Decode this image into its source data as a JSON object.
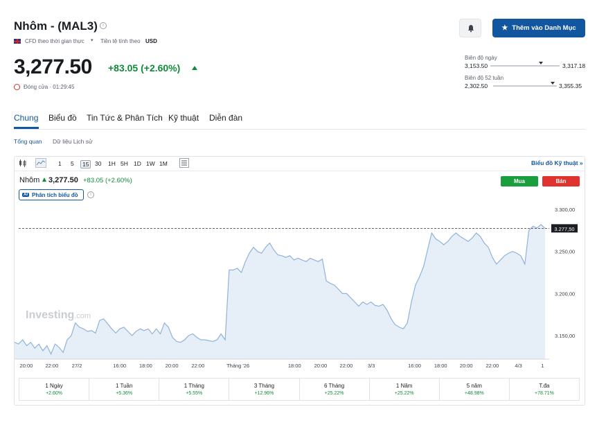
{
  "header": {
    "title": "Nhôm - (MAL3)",
    "cfd_label": "CFD theo thời gian thực",
    "currency_prefix": "Tiền tệ tính theo",
    "currency": "USD",
    "price": "3,277.50",
    "change": "+83.05 (+2.60%)",
    "closed_text": "Đóng cửa · 01:29:45",
    "watchlist_label": "Thêm vào Danh Mục"
  },
  "ranges": {
    "day_label": "Biên độ ngày",
    "day_low": "3,153.50",
    "day_high": "3,317.18",
    "day_position": 0.73,
    "week52_label": "Biên độ 52 tuần",
    "week52_low": "2,302.50",
    "week52_high": "3,355.35",
    "week52_position": 0.93
  },
  "tabs": [
    "Chung",
    "Biểu đồ",
    "Tin Tức & Phân Tích",
    "Kỹ thuật",
    "Diễn đàn"
  ],
  "subtabs": [
    "Tổng quan",
    "Dữ liệu Lịch sử"
  ],
  "toolbar": {
    "intervals": [
      "1",
      "5",
      "15",
      "30",
      "1H",
      "5H",
      "1D",
      "1W",
      "1M"
    ],
    "tech_chart_link": "Biểu đồ Kỹ thuật »"
  },
  "chart_header": {
    "name": "Nhôm",
    "price": "3,277.50",
    "change": "+83.05 (+2.60%)",
    "ai_label": "Phân tích biểu đồ",
    "buy": "Mua",
    "sell": "Bán",
    "watermark": "Investing",
    "watermark_suffix": ".com"
  },
  "chart_data": {
    "type": "area",
    "ylim": [
      3122,
      3305
    ],
    "yticks": [
      "3.300,00",
      "3.250,00",
      "3.200,00",
      "3.150,00"
    ],
    "ytick_values": [
      3300,
      3250,
      3200,
      3150
    ],
    "current_label": "3.277,50",
    "current_value": 3277.5,
    "xticks": [
      "20:00",
      "22:00",
      "27/2",
      "16:00",
      "18:00",
      "20:00",
      "22:00",
      "Tháng '26",
      "18:00",
      "20:00",
      "22:00",
      "3/3",
      "16:00",
      "18:00",
      "20:00",
      "22:00",
      "4/3",
      "1"
    ],
    "xtick_positions": [
      0.022,
      0.07,
      0.117,
      0.197,
      0.246,
      0.295,
      0.344,
      0.419,
      0.525,
      0.574,
      0.622,
      0.669,
      0.75,
      0.799,
      0.847,
      0.896,
      0.945,
      0.99
    ],
    "values": [
      3142,
      3140,
      3145,
      3138,
      3142,
      3135,
      3140,
      3132,
      3138,
      3128,
      3140,
      3136,
      3130,
      3145,
      3150,
      3165,
      3160,
      3158,
      3155,
      3156,
      3153,
      3168,
      3170,
      3164,
      3158,
      3153,
      3158,
      3160,
      3155,
      3150,
      3155,
      3158,
      3156,
      3158,
      3152,
      3158,
      3152,
      3165,
      3160,
      3148,
      3143,
      3142,
      3145,
      3150,
      3152,
      3148,
      3145,
      3145,
      3144,
      3143,
      3145,
      3152,
      3145,
      3228,
      3228,
      3230,
      3225,
      3238,
      3248,
      3255,
      3250,
      3248,
      3255,
      3260,
      3252,
      3246,
      3245,
      3243,
      3245,
      3240,
      3242,
      3240,
      3238,
      3242,
      3240,
      3238,
      3241,
      3215,
      3212,
      3210,
      3205,
      3200,
      3200,
      3195,
      3190,
      3185,
      3190,
      3187,
      3190,
      3186,
      3185,
      3187,
      3180,
      3170,
      3163,
      3160,
      3158,
      3165,
      3190,
      3210,
      3220,
      3232,
      3252,
      3272,
      3265,
      3262,
      3258,
      3262,
      3268,
      3272,
      3268,
      3265,
      3262,
      3266,
      3272,
      3268,
      3260,
      3255,
      3243,
      3235,
      3240,
      3245,
      3248,
      3250,
      3248,
      3245,
      3235,
      3275,
      3280,
      3278,
      3282,
      3277.5
    ]
  },
  "performance": [
    {
      "label": "1 Ngày",
      "value": "+2.60%"
    },
    {
      "label": "1 Tuần",
      "value": "+5.36%"
    },
    {
      "label": "1 Tháng",
      "value": "+5.55%"
    },
    {
      "label": "3 Tháng",
      "value": "+12.96%"
    },
    {
      "label": "6 Tháng",
      "value": "+25.22%"
    },
    {
      "label": "1 Năm",
      "value": "+25.22%"
    },
    {
      "label": "5 năm",
      "value": "+48.98%"
    },
    {
      "label": "T.đa",
      "value": "+78.71%"
    }
  ],
  "colors": {
    "accent": "#1256a0",
    "positive": "#0f8a38",
    "line": "#8fb3d9",
    "area": "#e6eef7"
  }
}
